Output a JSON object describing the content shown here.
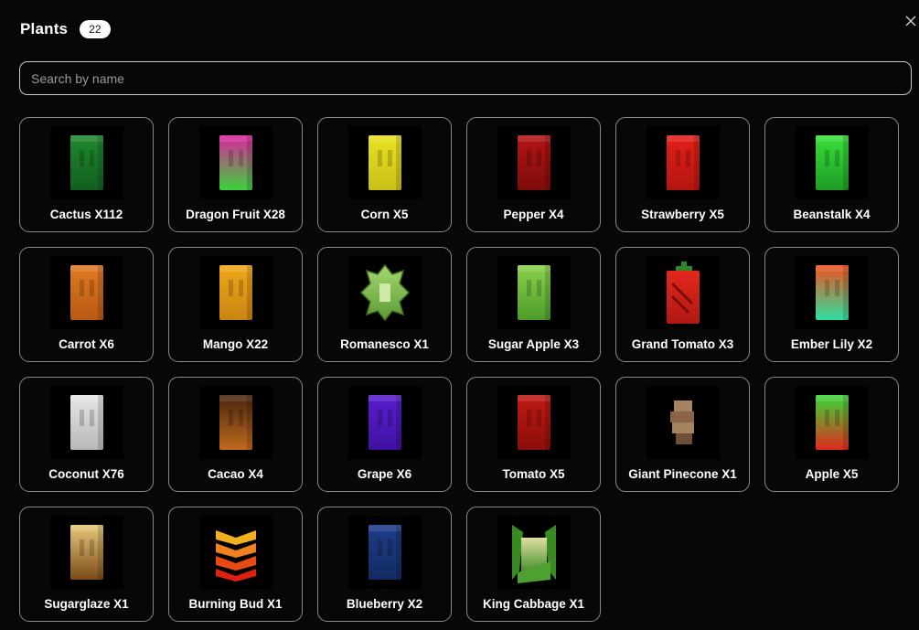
{
  "header": {
    "title": "Plants",
    "count": "22"
  },
  "search": {
    "placeholder": "Search by name",
    "value": ""
  },
  "plants": [
    {
      "label": "Cactus X112",
      "icon": "cactus-icon",
      "top": "#1f8a2e",
      "bottom": "#145e1f",
      "shape": "block"
    },
    {
      "label": "Dragon Fruit X28",
      "icon": "dragon-fruit-icon",
      "top": "#e0239e",
      "bottom": "#3ad23a",
      "shape": "block"
    },
    {
      "label": "Corn X5",
      "icon": "corn-icon",
      "top": "#e8e222",
      "bottom": "#c9c018",
      "shape": "block"
    },
    {
      "label": "Pepper X4",
      "icon": "pepper-icon",
      "top": "#b31414",
      "bottom": "#7e0c0c",
      "shape": "block"
    },
    {
      "label": "Strawberry X5",
      "icon": "strawberry-icon",
      "top": "#e3201a",
      "bottom": "#b51510",
      "shape": "block"
    },
    {
      "label": "Beanstalk X4",
      "icon": "beanstalk-icon",
      "top": "#38e03a",
      "bottom": "#1f9c26",
      "shape": "block"
    },
    {
      "label": "Carrot X6",
      "icon": "carrot-icon",
      "top": "#e07a22",
      "bottom": "#b85a14",
      "shape": "block"
    },
    {
      "label": "Mango X22",
      "icon": "mango-icon",
      "top": "#f0a81a",
      "bottom": "#c98410",
      "shape": "block"
    },
    {
      "label": "Romanesco X1",
      "icon": "romanesco-icon",
      "top": "#a8d870",
      "bottom": "#5a9a34",
      "shape": "spiky"
    },
    {
      "label": "Sugar Apple X3",
      "icon": "sugar-apple-icon",
      "top": "#8ad24c",
      "bottom": "#4e9c2a",
      "shape": "block"
    },
    {
      "label": "Grand Tomato X3",
      "icon": "grand-tomato-icon",
      "top": "#e3281e",
      "bottom": "#b01812",
      "shape": "tall"
    },
    {
      "label": "Ember Lily X2",
      "icon": "ember-lily-icon",
      "top": "#f0501e",
      "bottom": "#2ee0a0",
      "shape": "block"
    },
    {
      "label": "Coconut X76",
      "icon": "coconut-icon",
      "top": "#e6e6e6",
      "bottom": "#b8b8b8",
      "shape": "block"
    },
    {
      "label": "Cacao X4",
      "icon": "cacao-icon",
      "top": "#4a2510",
      "bottom": "#c06a1c",
      "shape": "block"
    },
    {
      "label": "Grape X6",
      "icon": "grape-icon",
      "top": "#5a1ecf",
      "bottom": "#3e12a0",
      "shape": "block"
    },
    {
      "label": "Tomato X5",
      "icon": "tomato-icon",
      "top": "#c01a14",
      "bottom": "#8a0e0c",
      "shape": "block"
    },
    {
      "label": "Giant Pinecone X1",
      "icon": "pinecone-icon",
      "top": "#a07a5a",
      "bottom": "#6e4e36",
      "shape": "pinecone"
    },
    {
      "label": "Apple X5",
      "icon": "apple-icon",
      "top": "#3ad83a",
      "bottom": "#e02a1e",
      "shape": "block"
    },
    {
      "label": "Sugarglaze X1",
      "icon": "sugarglaze-icon",
      "top": "#e8c878",
      "bottom": "#7a4a1a",
      "shape": "block"
    },
    {
      "label": "Burning Bud X1",
      "icon": "burning-bud-icon",
      "top": "#f0b020",
      "bottom": "#e02a10",
      "shape": "layers"
    },
    {
      "label": "Blueberry X2",
      "icon": "blueberry-icon",
      "top": "#1e3e8a",
      "bottom": "#142a62",
      "shape": "block"
    },
    {
      "label": "King Cabbage X1",
      "icon": "king-cabbage-icon",
      "top": "#e0e0a0",
      "bottom": "#3a8a24",
      "shape": "cabbage"
    }
  ]
}
